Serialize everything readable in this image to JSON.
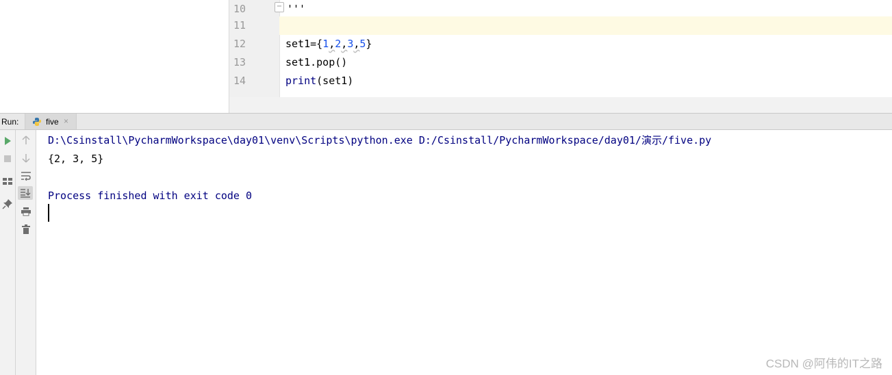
{
  "editor": {
    "lines": [
      {
        "number": "10",
        "code": "'''"
      },
      {
        "number": "11",
        "code": ""
      },
      {
        "number": "12",
        "code_parts": [
          "set1={",
          "1",
          ",",
          "2",
          ",",
          "3",
          ",",
          "5",
          "}"
        ]
      },
      {
        "number": "13",
        "code": "set1.pop()"
      },
      {
        "number": "14",
        "code_parts": [
          "print",
          "(set1)"
        ]
      }
    ]
  },
  "run_panel": {
    "label": "Run:",
    "tab_label": "five",
    "tab_close": "×"
  },
  "console": {
    "command": "D:\\Csinstall\\PycharmWorkspace\\day01\\venv\\Scripts\\python.exe D:/Csinstall/PycharmWorkspace/day01/演示/five.py",
    "output": "{2, 3, 5}",
    "exit_message": "Process finished with exit code 0"
  },
  "watermark": "CSDN @阿伟的IT之路",
  "icons": {
    "run": "play-icon",
    "stop": "stop-icon",
    "layout": "layout-icon",
    "pin": "pin-icon",
    "up": "arrow-up-icon",
    "down": "arrow-down-icon",
    "wrap": "soft-wrap-icon",
    "scroll": "scroll-to-end-icon",
    "print": "print-icon",
    "trash": "trash-icon"
  }
}
